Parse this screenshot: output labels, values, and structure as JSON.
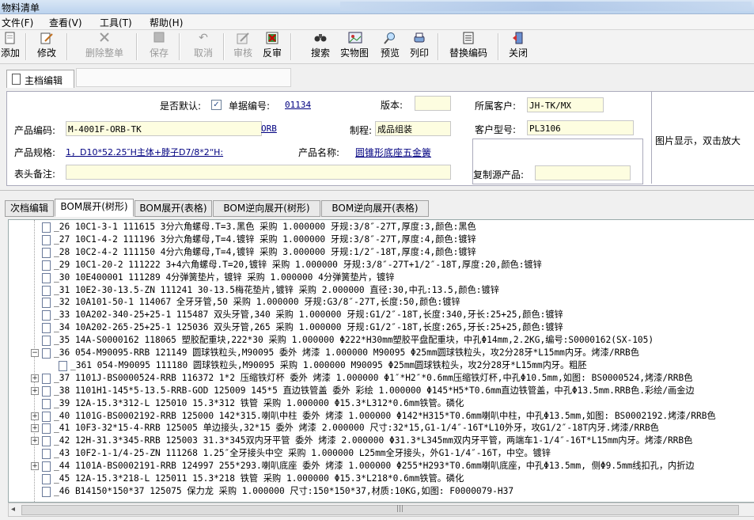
{
  "window": {
    "title": "物料清单"
  },
  "menu": [
    "文件(F)",
    "查看(V)",
    "工具(T)",
    "帮助(H)"
  ],
  "toolbar": [
    {
      "label": "添加",
      "icon": "add-doc-icon",
      "enabled": true
    },
    {
      "label": "修改",
      "icon": "edit-doc-icon",
      "enabled": true
    },
    {
      "label": "删除整单",
      "icon": "delete-icon",
      "enabled": false
    },
    {
      "label": "保存",
      "icon": "save-icon",
      "enabled": false
    },
    {
      "label": "取消",
      "icon": "undo-icon",
      "enabled": false
    },
    {
      "label": "审核",
      "icon": "audit-icon",
      "enabled": false
    },
    {
      "label": "反审",
      "icon": "unaudit-icon",
      "enabled": true
    },
    {
      "label": "搜索",
      "icon": "binoculars-icon",
      "enabled": true
    },
    {
      "label": "实物图",
      "icon": "picture-icon",
      "enabled": true
    },
    {
      "label": "预览",
      "icon": "magnifier-icon",
      "enabled": true
    },
    {
      "label": "列印",
      "icon": "printer-icon",
      "enabled": true
    },
    {
      "label": "替换编码",
      "icon": "replace-icon",
      "enabled": true
    },
    {
      "label": "关闭",
      "icon": "exit-icon",
      "enabled": true
    }
  ],
  "main_tab": "主档编辑",
  "form": {
    "default_label": "是否默认:",
    "default_checked": true,
    "doc_no_label": "单据编号:",
    "doc_no": "01134",
    "version_label": "版本:",
    "version": "",
    "customer_label": "所属客户:",
    "customer": "JH-TK/MX",
    "product_code_label": "产品编码:",
    "product_code": "M-4001F-ORB-TK",
    "product_code_suffix": "ORB",
    "process_label": "制程:",
    "process": "成品组装",
    "cust_model_label": "客户型号:",
    "cust_model": "PL3106",
    "spec_label": "产品规格:",
    "spec": "1，D10*52.25″H主体+脖子D7/8*2“H:",
    "name_label": "产品名称:",
    "name": "圆锥形底座五金簧",
    "remark_label": "表头备注:",
    "remark": "",
    "copy_src_label": "复制源产品:",
    "copy_src": "",
    "image_hint": "图片显示，双击放大"
  },
  "tabs": [
    "次档编辑",
    "BOM展开(树形)",
    "BOM展开(表格)",
    "BOM逆向展开(树形)",
    "BOM逆向展开(表格)"
  ],
  "active_tab": 1,
  "tree_rows": [
    {
      "text": "_26 10C1-3-1 111615 3分六角螺母.T=3.黑色 采购  1.000000 牙规:3/8″-27T,厚度:3,颜色:黑色",
      "level": 1,
      "exp": ""
    },
    {
      "text": "_27 10C1-4-2 111196 3分六角螺母,T=4.镀锌 采购  1.000000 牙规:3/8″-27T,厚度:4,颜色:镀锌",
      "level": 1,
      "exp": ""
    },
    {
      "text": "_28 10C2-4-2 111150 4分六角螺母,T=4,镀锌 采购  3.000000 牙规:1/2″-18T,厚度:4,颜色:镀锌",
      "level": 1,
      "exp": ""
    },
    {
      "text": "_29 10C1-20-2 111222 3+4六角螺母.T=20,镀锌 采购  1.000000 牙规:3/8″-27T+1/2″-18T,厚度:20,颜色:镀锌",
      "level": 1,
      "exp": ""
    },
    {
      "text": "_30 10E400001 111289 4分弹簧垫片，镀锌 采购  1.000000 4分弹簧垫片，镀锌",
      "level": 1,
      "exp": ""
    },
    {
      "text": "_31 10E2-30-13.5-ZN 111241 30-13.5梅花垫片,镀锌 采购  2.000000 直径:30,中孔:13.5,颜色:镀锌",
      "level": 1,
      "exp": ""
    },
    {
      "text": "_32 10A101-50-1 114067 全牙牙管,50 采购  1.000000 牙规:G3/8″-27T,长度:50,颜色:镀锌",
      "level": 1,
      "exp": ""
    },
    {
      "text": "_33 10A202-340-25+25-1 115487 双头牙管,340 采购  1.000000 牙规:G1/2″-18T,长度:340,牙长:25+25,颜色:镀锌",
      "level": 1,
      "exp": ""
    },
    {
      "text": "_34 10A202-265-25+25-1 125036 双头牙管,265 采购  1.000000 牙规:G1/2″-18T,长度:265,牙长:25+25,颜色:镀锌",
      "level": 1,
      "exp": ""
    },
    {
      "text": "_35 14A-S0000162 118065 塑胶配重块,222*30 采购  1.000000 Φ222*H30mm塑胶平盘配重块，中孔Φ14mm,2.2KG,编号:S0000162(SX-105)",
      "level": 1,
      "exp": ""
    },
    {
      "text": "_36 054-M90095-RRB 121149 圆球铁粒头,M90095 委外 烤漆 1.000000 M90095 Φ25mm圆球铁粒头，攻2分28牙*L15mm内牙。烤漆/RRB色",
      "level": 1,
      "exp": "-"
    },
    {
      "text": "_361 054-M90095 111180 圆球铁粒头,M90095 采购  1.000000 M90095 Φ25mm圆球铁粒头，攻2分28牙*L15mm内牙。粗胚",
      "level": 2,
      "exp": ""
    },
    {
      "text": "_37 1101J-BS0000524-RRB 116372 1*2 压缩铁灯杯 委外 烤漆 1.000000 Φ1″*H2″*0.6mm压缩铁灯杯,中孔Φ10.5mm,如图: BS0000524,烤漆/RRB色",
      "level": 1,
      "exp": "+"
    },
    {
      "text": "_38 1101H1-145*5-13.5-RRB-GOD 125009 145*5 直边铁管盖 委外 彩绘 1.000000 Φ145*H5*T0.6mm直边铁管盖，中孔Φ13.5mm.RRB色.彩绘/画金边",
      "level": 1,
      "exp": "+"
    },
    {
      "text": "_39 12A-15.3*312-L 125010 15.3*312 铁管 采购  1.000000 Φ15.3*L312*0.6mm铁管。磷化",
      "level": 1,
      "exp": ""
    },
    {
      "text": "_40 1101G-BS0002192-RRB 125000 142*315.喇叭中柱 委外 烤漆 1.000000 Φ142*H315*T0.6mm喇叭中柱，中孔Φ13.5mm,如图: BS0002192.烤漆/RRB色",
      "level": 1,
      "exp": "+"
    },
    {
      "text": "_41 10F3-32*15-4-RRB 125005 单边接头,32*15 委外 烤漆 2.000000 尺寸:32*15,G1-1/4″-16T*L10外牙，攻G1/2″-18T内牙.烤漆/RRB色",
      "level": 1,
      "exp": "+"
    },
    {
      "text": "_42 12H-31.3*345-RRB 125003 31.3*345双内牙平管 委外 烤漆 2.000000 Φ31.3*L345mm双内牙平管，两端车1-1/4″-16T*L15mm内牙。烤漆/RRB色",
      "level": 1,
      "exp": "+"
    },
    {
      "text": "_43 10F2-1-1/4-25-ZN 111268 1.25″全牙接头中空 采购  1.000000 L25mm全牙接头，外G1-1/4″-16T，中空。镀锌",
      "level": 1,
      "exp": ""
    },
    {
      "text": "_44 1101A-BS0002191-RRB 124997 255*293.喇叭底座 委外 烤漆 1.000000 Φ255*H293*T0.6mm喇叭底座，中孔Φ13.5mm, 侧Φ9.5mm线扣孔，内折边",
      "level": 1,
      "exp": "+"
    },
    {
      "text": "_45 12A-15.3*218-L 125011 15.3*218 铁管 采购  1.000000 Φ15.3*L218*0.6mm铁管。磷化",
      "level": 1,
      "exp": ""
    },
    {
      "text": "_46 B14150*150*37 125075 保力龙 采购  1.000000 尺寸:150*150*37,材质:10KG,如图: F0000079-H37",
      "level": 1,
      "exp": ""
    }
  ]
}
